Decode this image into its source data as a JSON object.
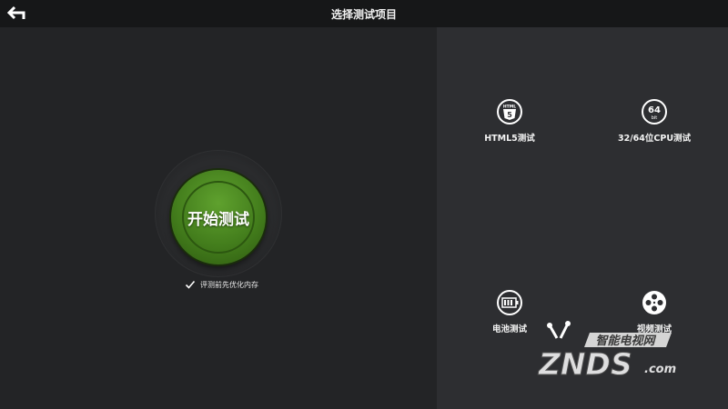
{
  "header": {
    "title": "选择测试项目",
    "back_icon": "back-arrow-icon"
  },
  "main": {
    "start_button_label": "开始测试",
    "optimize_option_label": "评测前先优化内存",
    "optimize_option_checked": true
  },
  "tests": [
    {
      "label": "HTML5测试",
      "icon": "html5-icon"
    },
    {
      "label": "32/64位CPU测试",
      "icon": "cpu-64bit-icon"
    },
    {
      "label": "电池测试",
      "icon": "battery-icon"
    },
    {
      "label": "视频测试",
      "icon": "film-reel-icon"
    }
  ],
  "icon_text": {
    "html5_top": "HTML",
    "html5_num": "5",
    "cpu_num": "64",
    "cpu_bit": "bit"
  },
  "watermark": {
    "tagline": "智能电视网",
    "brand": "ZNDS",
    "suffix": ".com"
  },
  "colors": {
    "background": "#222325",
    "right_panel": "#2d2e31",
    "topbar": "#161718",
    "start_green": "#4a8a21"
  }
}
